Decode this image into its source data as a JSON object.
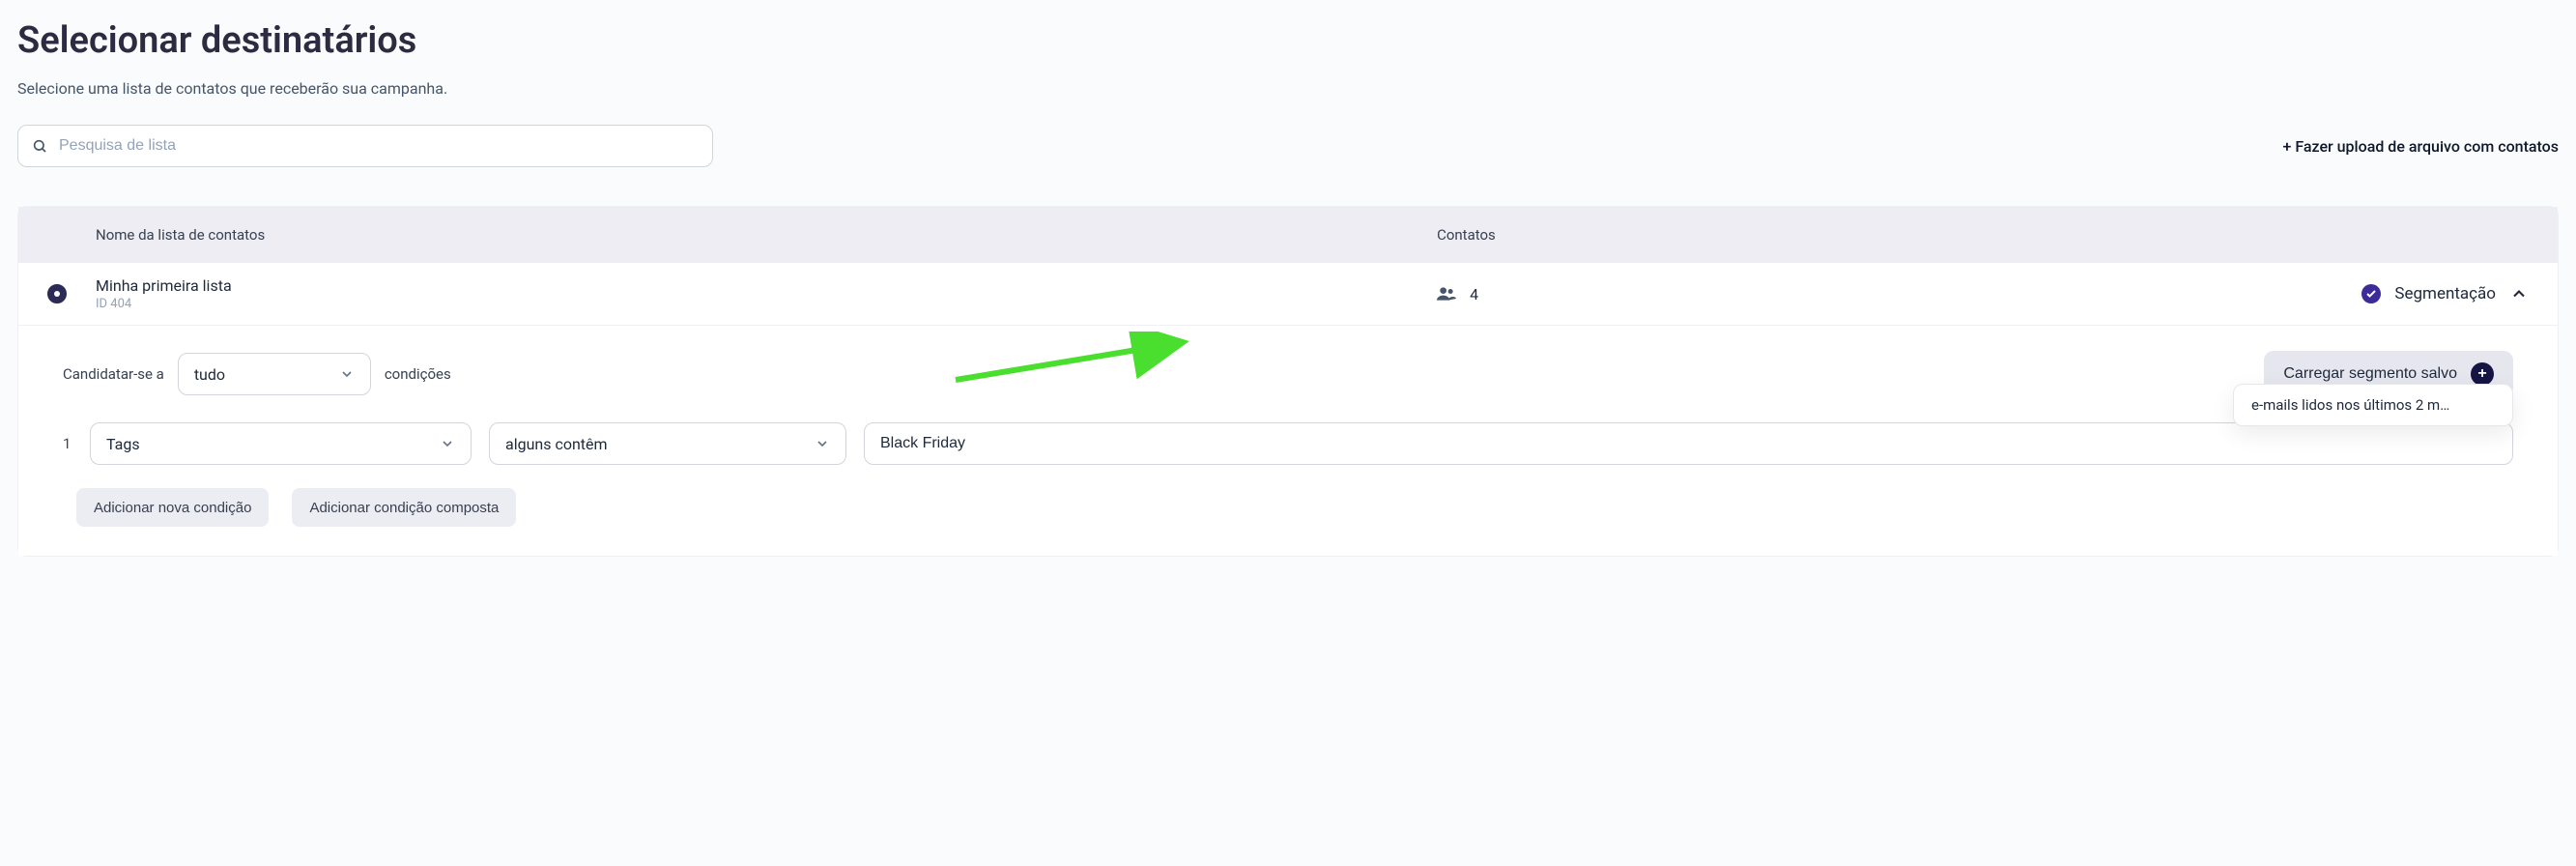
{
  "page": {
    "title": "Selecionar destinatários",
    "subtitle": "Selecione uma lista de contatos que receberão sua campanha."
  },
  "search": {
    "placeholder": "Pesquisa de lista",
    "value": ""
  },
  "upload_link": "+ Fazer upload de arquivo com contatos",
  "table": {
    "headers": {
      "name": "Nome da lista de contatos",
      "contacts": "Contatos"
    },
    "row": {
      "list_name": "Minha primeira lista",
      "list_id": "ID 404",
      "contacts_count": "4",
      "segmentation_label": "Segmentação"
    }
  },
  "segmentation": {
    "apply_label": "Candidatar-se a",
    "match_select": "tudo",
    "conditions_label": "condições",
    "load_saved_button": "Carregar segmento salvo",
    "condition": {
      "index": "1",
      "field": "Tags",
      "operator": "alguns contêm",
      "value": "Black Friday"
    },
    "add_condition_button": "Adicionar nova condição",
    "add_composite_button": "Adicionar condição composta",
    "saved_segment_option": "e-mails lidos nos últimos 2 m…"
  }
}
